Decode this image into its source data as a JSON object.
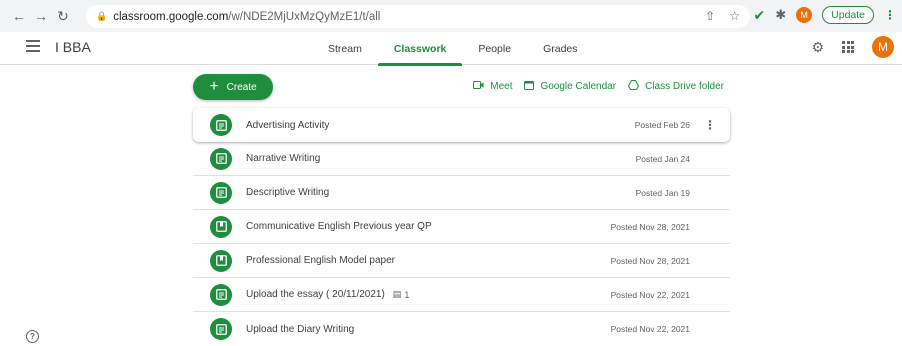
{
  "browser": {
    "url_host": "classroom.google.com",
    "url_path": "/w/NDE2MjUxMzQyMzE1/t/all",
    "profile_initial": "M",
    "update_label": "Update"
  },
  "header": {
    "class_name": "I BBA",
    "tabs": [
      {
        "label": "Stream"
      },
      {
        "label": "Classwork",
        "active": true
      },
      {
        "label": "People"
      },
      {
        "label": "Grades"
      }
    ],
    "avatar_initial": "M"
  },
  "toolbar": {
    "create_label": "Create",
    "meet_label": "Meet",
    "calendar_label": "Google Calendar",
    "drive_label": "Class Drive folder"
  },
  "items": [
    {
      "title": "Advertising Activity",
      "posted": "Posted Feb 26",
      "type": "assignment"
    },
    {
      "title": "Narrative Writing",
      "posted": "Posted Jan 24",
      "type": "assignment"
    },
    {
      "title": "Descriptive Writing",
      "posted": "Posted Jan 19",
      "type": "assignment"
    },
    {
      "title": "Communicative English Previous year QP",
      "posted": "Posted Nov 28, 2021",
      "type": "material"
    },
    {
      "title": "Professional English Model paper",
      "posted": "Posted Nov 28, 2021",
      "type": "material"
    },
    {
      "title": "Upload the essay ( 20/11/2021)",
      "posted": "Posted Nov 22, 2021",
      "type": "assignment",
      "comments": "1"
    },
    {
      "title": "Upload the Diary Writing",
      "posted": "Posted Nov 22, 2021",
      "type": "assignment"
    }
  ],
  "colors": {
    "accent": "#1e8e3e",
    "avatar": "#e8710a"
  }
}
